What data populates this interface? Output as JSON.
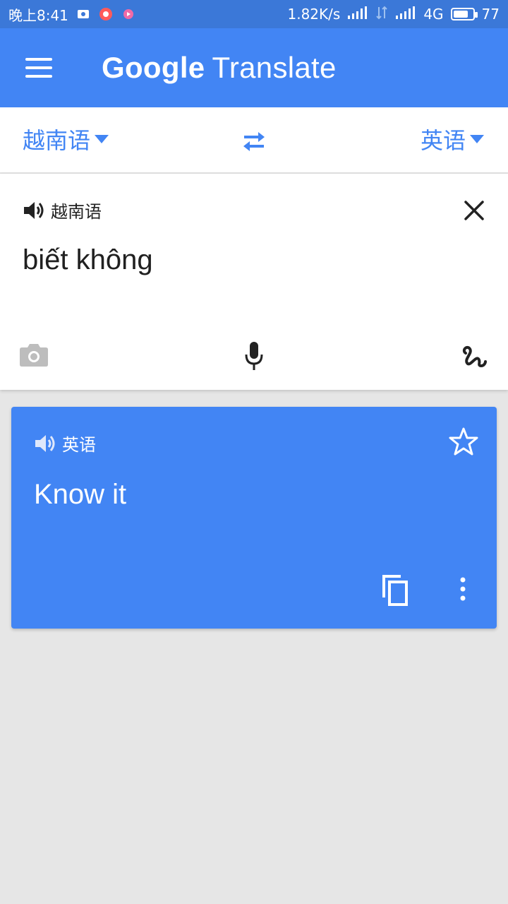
{
  "status_bar": {
    "time": "晚上8:41",
    "network_speed": "1.82K/s",
    "network_type": "4G",
    "battery": "77",
    "battery_level_percent": 77
  },
  "app_bar": {
    "title_google": "Google",
    "title_translate": "Translate",
    "menu_icon": "menu-icon"
  },
  "language_bar": {
    "source_language": "越南语",
    "target_language": "英语",
    "swap_icon": "swap-icon"
  },
  "input_card": {
    "language_label": "越南语",
    "text": "biết không",
    "icons": [
      "speaker-icon",
      "close-icon",
      "camera-icon",
      "microphone-icon",
      "handwriting-icon"
    ]
  },
  "result_card": {
    "language_label": "英语",
    "text": "Know it",
    "icons": [
      "speaker-icon",
      "star-icon",
      "copy-icon",
      "more-vert-icon"
    ]
  },
  "colors": {
    "status_bar": "#3b78d8",
    "primary": "#4285f4",
    "background": "#e6e6e6",
    "card": "#ffffff",
    "text_dark": "#202020",
    "icon_gray": "#bdbdbd"
  }
}
